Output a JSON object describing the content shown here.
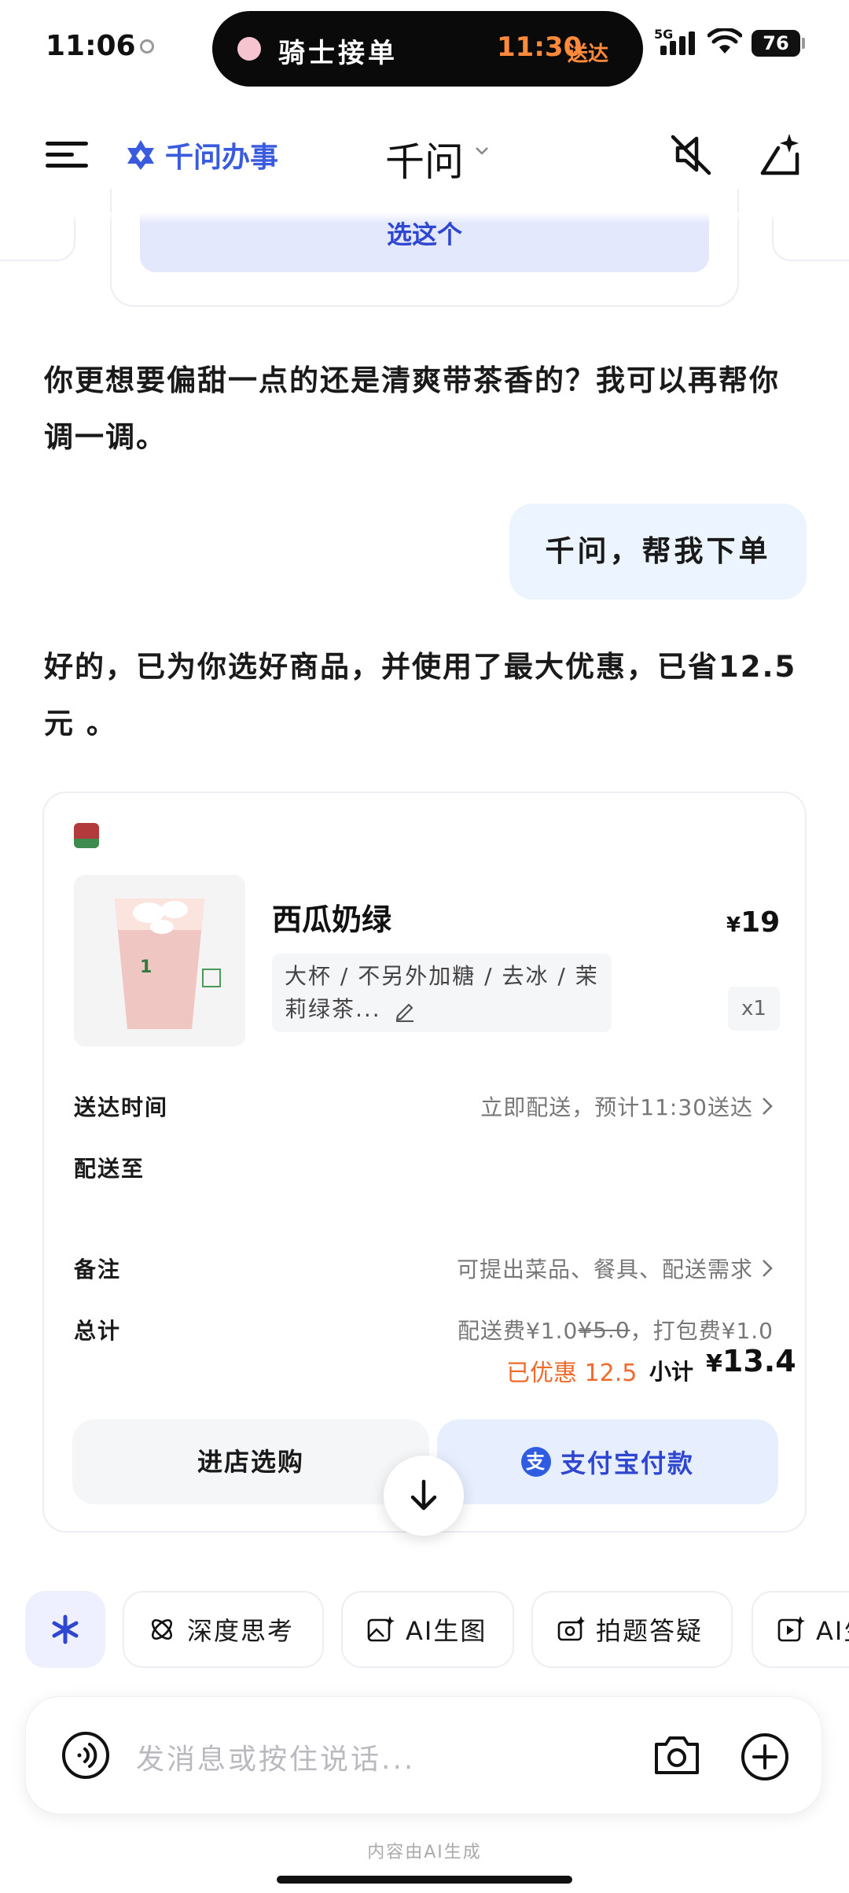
{
  "status_bar": {
    "time": "11:06",
    "activity": "骑士接单",
    "eta_time": "11:30",
    "eta_suffix": "送达",
    "network": "5G",
    "battery": "76"
  },
  "header": {
    "brand": "千问办事",
    "title": "千问",
    "icons": [
      "menu-icon",
      "mute-icon",
      "sparkle-edit-icon"
    ]
  },
  "previous_card": {
    "select_label": "选这个"
  },
  "messages": [
    {
      "role": "assistant",
      "text": "你更想要偏甜一点的还是清爽带茶香的？我可以再帮你调一调。"
    },
    {
      "role": "user",
      "text": "千问，帮我下单"
    },
    {
      "role": "assistant",
      "text": "好的，已为你选好商品，并使用了最大优惠，已省12.5元 。"
    }
  ],
  "order": {
    "product_name": "西瓜奶绿",
    "price_symbol": "¥",
    "price": "19",
    "spec_line1": "大杯 / 不另外加糖 / 去冰 / 茉",
    "spec_line2": "莉绿茶...",
    "quantity": "x1",
    "delivery_time_label": "送达时间",
    "delivery_time_value": "立即配送，预计11:30送达",
    "deliver_to_label": "配送至",
    "deliver_to_value": "",
    "note_label": "备注",
    "note_value": "可提出菜品、餐具、配送需求",
    "total_label": "总计",
    "fee_text_a": "配送费¥1.0",
    "fee_original": "¥5.0",
    "fee_text_b": "，打包费¥1.0",
    "discount": "已优惠 12.5",
    "subtotal_label": "小计",
    "subtotal_symbol": "¥",
    "subtotal_value": "13.4",
    "store_button": "进店选购",
    "pay_button": "支付宝付款",
    "alipay_glyph": "支"
  },
  "chips": [
    {
      "label": "深度思考",
      "icon": "atom-icon"
    },
    {
      "label": "AI生图",
      "icon": "image-ai-icon"
    },
    {
      "label": "拍题答疑",
      "icon": "camera-question-icon"
    },
    {
      "label": "AI生",
      "icon": "video-ai-icon"
    }
  ],
  "input": {
    "placeholder": "发消息或按住说话..."
  },
  "footer_note": "内容由AI生成",
  "colors": {
    "brand_blue": "#3a5bdd",
    "pay_blue": "#2f47d0",
    "discount_orange": "#ef6b2c",
    "eta_orange": "#ff8a3c",
    "user_bubble": "#ebf4ff"
  }
}
